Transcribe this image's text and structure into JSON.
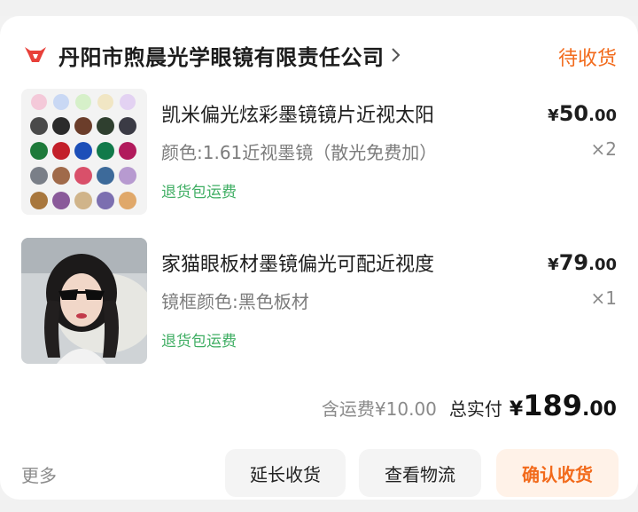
{
  "order": {
    "shop_name": "丹阳市煦晨光学眼镜有限责任公司",
    "status": "待收货",
    "brand_color": "#e8403a",
    "accent_color": "#f26a1b",
    "items": [
      {
        "title": "凯米偏光炫彩墨镜镜片近视太阳",
        "spec": "颜色:1.61近视墨镜（散光免费加）",
        "tag": "退货包运费",
        "price_currency": "¥",
        "price_int": "50",
        "price_dec": ".00",
        "qty": "×2",
        "image": "lens-color-swatches"
      },
      {
        "title": "家猫眼板材墨镜偏光可配近视度",
        "spec": "镜框颜色:黑色板材",
        "tag": "退货包运费",
        "price_currency": "¥",
        "price_int": "79",
        "price_dec": ".00",
        "qty": "×1",
        "image": "model-wearing-cat-eye-sunglasses"
      }
    ],
    "shipping": "含运费¥10.00",
    "total_label": "总实付",
    "total_currency": "¥",
    "total_int": "189",
    "total_dec": ".00"
  },
  "actions": {
    "more": "更多",
    "extend": "延长收货",
    "logistics": "查看物流",
    "confirm": "确认收货"
  },
  "icons": {
    "shop_logo": "bull-head-logo-icon",
    "shop_arrow": "chevron-right-icon"
  }
}
